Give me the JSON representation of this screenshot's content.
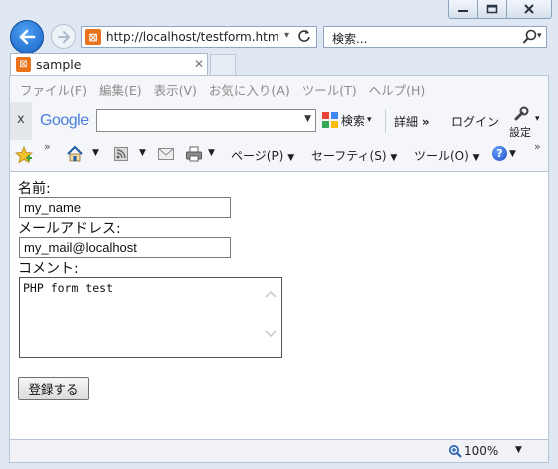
{
  "address": {
    "url": "http://localhost/testform.htm"
  },
  "search": {
    "placeholder": "検索..."
  },
  "tab": {
    "title": "sample"
  },
  "menu": [
    "ファイル(F)",
    "編集(E)",
    "表示(V)",
    "お気に入り(A)",
    "ツール(T)",
    "ヘルプ(H)"
  ],
  "google_toolbar": {
    "close": "x",
    "logo": "Google",
    "search_label": "検索",
    "details_label": "詳細",
    "login_label": "ログイン",
    "settings_label": "設定"
  },
  "command_bar": {
    "page": "ページ(P)",
    "safety": "セーフティ(S)",
    "tools": "ツール(O)"
  },
  "form": {
    "name_label": "名前:",
    "name_value": "my_name",
    "email_label": "メールアドレス:",
    "email_value": "my_mail@localhost",
    "comment_label": "コメント:",
    "comment_value": "PHP form test",
    "submit_label": "登録する"
  },
  "status": {
    "zoom": "100%"
  },
  "colors": {
    "accent": "#1660c4",
    "favicon": "#e8731a",
    "chrome_bg": "#dfe8f2"
  }
}
